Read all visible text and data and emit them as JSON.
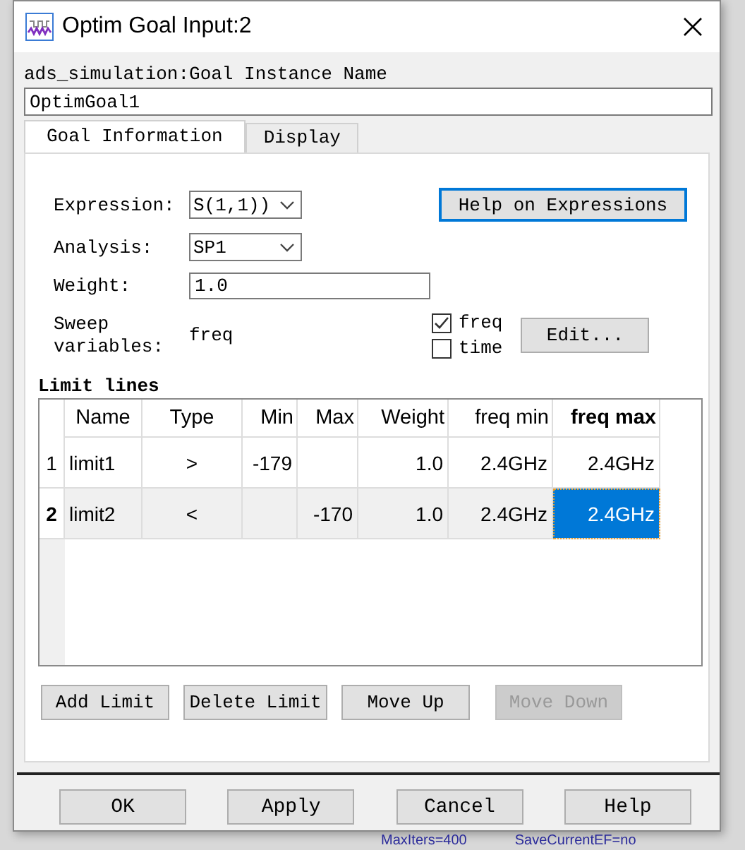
{
  "window": {
    "title": "Optim Goal Input:2"
  },
  "instance": {
    "label": "ads_simulation:Goal Instance Name",
    "value": "OptimGoal1"
  },
  "tabs": [
    {
      "label": "Goal Information",
      "selected": true
    },
    {
      "label": "Display",
      "selected": false
    }
  ],
  "expression": {
    "label": "Expression:",
    "value": "S(1,1))"
  },
  "help_button": {
    "label": "Help on Expressions",
    "focused": true
  },
  "analysis": {
    "label": "Analysis:",
    "value": "SP1"
  },
  "weight": {
    "label": "Weight:",
    "value": "1.0"
  },
  "sweep": {
    "label": "Sweep variables:",
    "value": "freq",
    "options": [
      {
        "label": "freq",
        "checked": true
      },
      {
        "label": "time",
        "checked": false
      }
    ],
    "edit_button": "Edit..."
  },
  "limit_lines": {
    "title": "Limit lines",
    "columns": [
      {
        "label": "Name",
        "selected": false
      },
      {
        "label": "Type",
        "selected": false
      },
      {
        "label": "Min",
        "selected": false
      },
      {
        "label": "Max",
        "selected": false
      },
      {
        "label": "Weight",
        "selected": false
      },
      {
        "label": "freq min",
        "selected": false
      },
      {
        "label": "freq max",
        "selected": true
      }
    ],
    "rows": [
      {
        "number": "1",
        "selected": false,
        "cells": [
          "limit1",
          ">",
          "-179",
          "",
          "1.0",
          "2.4GHz",
          "2.4GHz"
        ]
      },
      {
        "number": "2",
        "selected": true,
        "cells": [
          "limit2",
          "<",
          "",
          "-170",
          "1.0",
          "2.4GHz",
          "2.4GHz"
        ]
      }
    ],
    "buttons": [
      {
        "label": "Add Limit",
        "disabled": false
      },
      {
        "label": "Delete Limit",
        "disabled": false
      },
      {
        "label": "Move Up",
        "disabled": false
      },
      {
        "label": "Move Down",
        "disabled": true
      }
    ]
  },
  "buttons": [
    "OK",
    "Apply",
    "Cancel",
    "Help"
  ],
  "background": {
    "texts": [
      "MaxIters=400",
      "SaveCurrentEF=no"
    ]
  }
}
